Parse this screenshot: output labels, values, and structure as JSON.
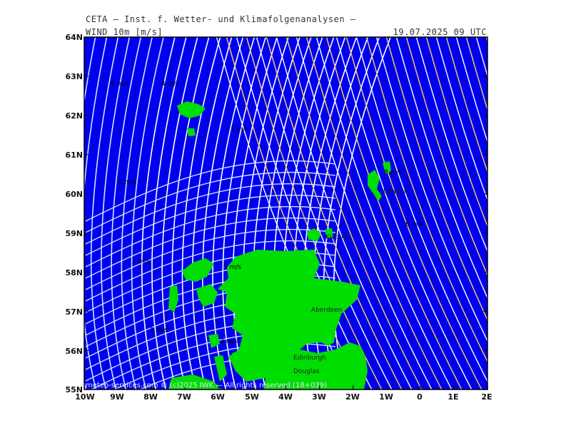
{
  "header": {
    "title": "CETA — Inst. f. Wetter- und Klimafolgenanalysen —",
    "parameter": "WIND 10m [m/s]",
    "datetime": "19.07.2025 09 UTC"
  },
  "axes": {
    "latitudes": [
      "64N",
      "63N",
      "62N",
      "61N",
      "60N",
      "59N",
      "58N",
      "57N",
      "56N",
      "55N"
    ],
    "longitudes": [
      "10W",
      "9W",
      "8W",
      "7W",
      "6W",
      "5W",
      "4W",
      "3W",
      "2W",
      "1W",
      "0",
      "1E",
      "2E"
    ]
  },
  "places": [
    {
      "name": "Lerwick"
    },
    {
      "name": "Kirkwall"
    },
    {
      "name": "Aberdeen"
    },
    {
      "name": "Edinburgh"
    },
    {
      "name": "Douglas"
    }
  ],
  "wind_labels": [
    "6 m/s",
    "4 m/s",
    "1 m/s",
    "1 m/s",
    "8 m/s",
    "6 m/s",
    "2 m/s",
    "1 m/s",
    "1 m/s",
    "3 m/s"
  ],
  "footer": "meteo-services.com © (c)2025 IWK — All rights reserved (18+039)",
  "colors": {
    "sea": "#0000ee",
    "land": "#00dd00",
    "streamline_fast": "#ffffff",
    "streamline_slow": "#ffd060",
    "streamline_light": "#cce6ff"
  }
}
